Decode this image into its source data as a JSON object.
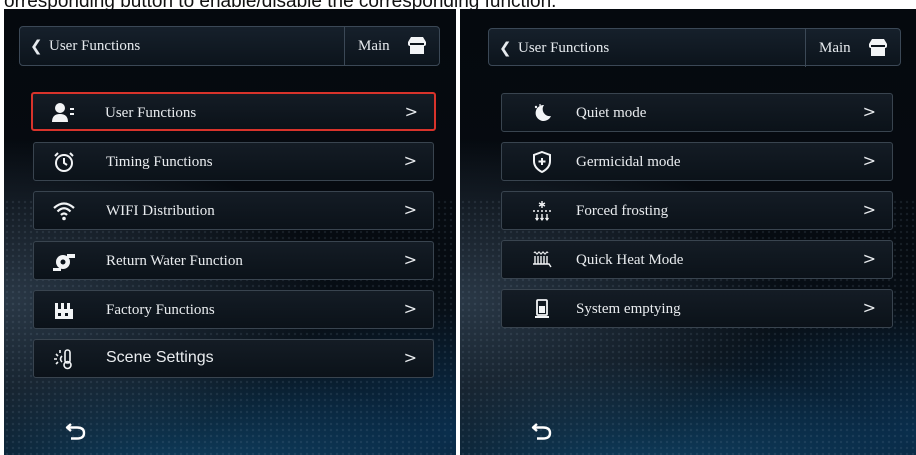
{
  "caption": "orresponding button to enable/disable the corresponding function.",
  "left_screen": {
    "header": {
      "title": "User Functions",
      "main_label": "Main"
    },
    "items": [
      {
        "label": "User Functions",
        "icon": "user-settings-icon",
        "selected": true
      },
      {
        "label": "Timing Functions",
        "icon": "alarm-clock-icon",
        "selected": false
      },
      {
        "label": "WIFI Distribution",
        "icon": "wifi-icon",
        "selected": false
      },
      {
        "label": "Return Water Function",
        "icon": "water-pump-icon",
        "selected": false
      },
      {
        "label": "Factory Functions",
        "icon": "factory-icon",
        "selected": false
      },
      {
        "label": "Scene Settings",
        "icon": "sun-thermometer-icon",
        "selected": false
      }
    ]
  },
  "right_screen": {
    "header": {
      "title": "User Functions",
      "main_label": "Main"
    },
    "items": [
      {
        "label": "Quiet mode",
        "icon": "moon-icon"
      },
      {
        "label": "Germicidal mode",
        "icon": "shield-plus-icon"
      },
      {
        "label": "Forced frosting",
        "icon": "snowflake-defrost-icon"
      },
      {
        "label": "Quick Heat Mode",
        "icon": "heating-coil-icon"
      },
      {
        "label": "System emptying",
        "icon": "tank-icon"
      }
    ]
  },
  "colors": {
    "selected_border": "#d8332b",
    "item_border": "#39444f",
    "text": "#e9ecef"
  }
}
